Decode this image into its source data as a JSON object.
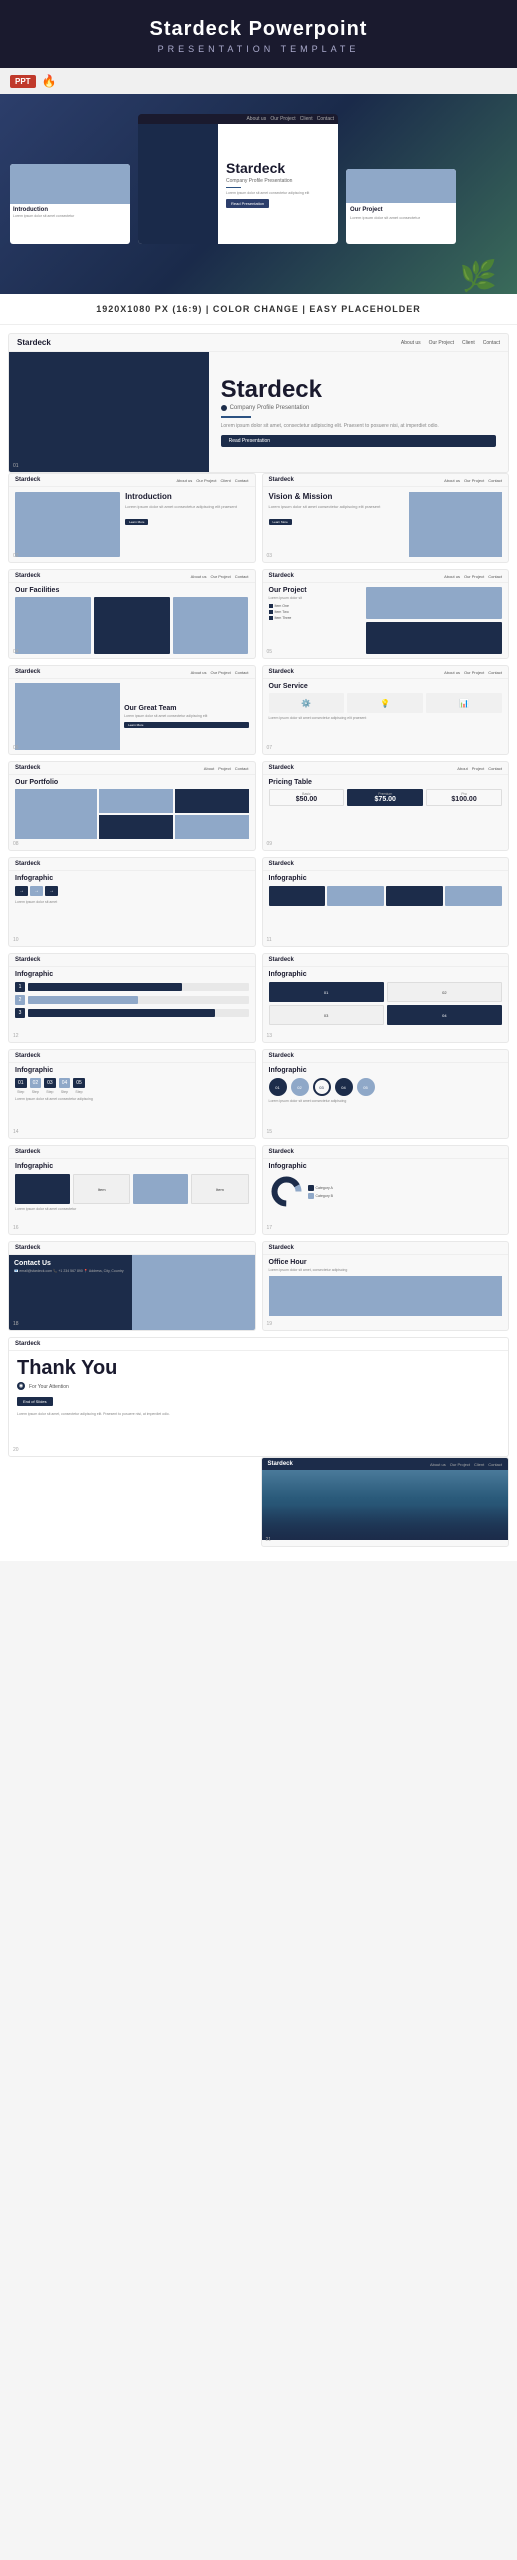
{
  "header": {
    "title": "Stardeck Powerpoint",
    "subtitle": "PRESENTATION TEMPLATE"
  },
  "ppt_badge": "PPT",
  "fire_icon": "🔥",
  "dimension_label": "1920X1080 PX (16:9) | COLOR CHANGE | EASY PLACEHOLDER",
  "brand": "Stardeck",
  "brand_sub": "Company Profile Presentation",
  "hero_btn": "Read Presentation",
  "hero_desc": "Lorem ipsum dolor sit amet, consectetur adipiscing elit. Praesent to posuere nisi, at imperdiet odio.",
  "nav_links": [
    "About us",
    "Our Project",
    "Client",
    "Contact"
  ],
  "slides": [
    {
      "id": 1,
      "label": "Stardeck Hero"
    },
    {
      "id": 2,
      "label": "Introduction"
    },
    {
      "id": 3,
      "label": "Vision & Mission"
    },
    {
      "id": 4,
      "label": "Our Facilities"
    },
    {
      "id": 5,
      "label": "Our Project"
    },
    {
      "id": 6,
      "label": "Our Great Team"
    },
    {
      "id": 7,
      "label": "Our Service"
    },
    {
      "id": 8,
      "label": "Our Portfolio"
    },
    {
      "id": 9,
      "label": "Pricing Table"
    },
    {
      "id": 10,
      "label": "Infographic"
    },
    {
      "id": 11,
      "label": "Infographic"
    },
    {
      "id": 12,
      "label": "Infographic"
    },
    {
      "id": 13,
      "label": "Infographic"
    },
    {
      "id": 14,
      "label": "Infographic"
    },
    {
      "id": 15,
      "label": "Infographic"
    },
    {
      "id": 16,
      "label": "Infographic"
    },
    {
      "id": 17,
      "label": "Infographic"
    },
    {
      "id": 18,
      "label": "Contact Us"
    },
    {
      "id": 19,
      "label": "Office Hour"
    },
    {
      "id": 20,
      "label": "Thank You"
    },
    {
      "id": 21,
      "label": "City"
    }
  ],
  "intro_title": "Introduction",
  "vision_title": "Vision & Mission",
  "facilities_title": "Our Facilities",
  "project_title": "Our Project",
  "team_title": "Our Great Team",
  "service_title": "Our Service",
  "portfolio_title": "Our Portfolio",
  "pricing_title": "Pricing Table",
  "infographic_title": "Infographic",
  "contact_title": "Contact Us",
  "office_title": "Office Hour",
  "thanks_title": "Thank You",
  "thanks_sub": "For Your Attention",
  "thanks_btn": "End of Slides",
  "pricing": {
    "basic": {
      "label": "Basic",
      "price": "$50.00"
    },
    "premium": {
      "label": "Premium",
      "price": "$75.00",
      "highlighted": true
    },
    "pro": {
      "label": "Pro",
      "price": "$100.00"
    }
  },
  "placeholder_text": "Lorem ipsum dolor sit amet, consectetur adipiscing elit. Praesent to posuere nisi, at imperdiet odio.",
  "nums": [
    "01.",
    "02.",
    "03.",
    "04.",
    "05."
  ],
  "office_sub": "Lorem ipsum dolor sit amet, consectetur adipiscing"
}
